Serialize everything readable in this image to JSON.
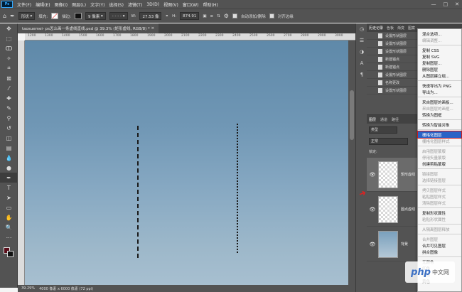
{
  "menubar": {
    "logo": "Ps",
    "items": [
      "文件(F)",
      "编辑(E)",
      "图像(I)",
      "图层(L)",
      "文字(Y)",
      "选择(S)",
      "滤镜(T)",
      "3D(D)",
      "视图(V)",
      "窗口(W)",
      "帮助(H)"
    ],
    "minimize": "—",
    "maximize": "□",
    "close": "✕"
  },
  "options": {
    "mode": "形状",
    "fill_label": "填充:",
    "stroke_label": "描边:",
    "stroke_width": "9 像素",
    "width_label": "W:",
    "width_value": "27.53 像",
    "height_label": "H:",
    "height_value": "874.91",
    "auto_add_label": "自动添加/删除",
    "align_edges_label": "对齐边缘"
  },
  "document": {
    "tab_title": "taosuemei- ps怎么画一条虚线直线.psd @ 39.3% (矩形虚线, RGB/8) *",
    "close_x": "×"
  },
  "ruler_ticks": [
    "1200",
    "1300",
    "1400",
    "1500",
    "1600",
    "1700",
    "1800",
    "1900",
    "2000",
    "2100",
    "2200",
    "2300",
    "2400",
    "2500",
    "2600",
    "2700",
    "2800",
    "2900",
    "3000"
  ],
  "status": {
    "zoom": "39.29%",
    "doc_size": "4000 像素 x 6000 像素 (72 ppi)"
  },
  "history": {
    "tabs": [
      "历史记录",
      "色板",
      "渐变",
      "图案"
    ],
    "rows": [
      "设置形状图层",
      "设置形状图层",
      "设置形状图层",
      "新建锚点",
      "新建锚点",
      "设置形状图层",
      "名称更改",
      "设置形状图层"
    ]
  },
  "layers": {
    "tabs": [
      "图层",
      "通道",
      "路径"
    ],
    "filter": "类型",
    "blend": "正常",
    "lock_label": "锁定:",
    "items": [
      {
        "name": "矩形虚线",
        "thumb": "checker"
      },
      {
        "name": "圆点虚线",
        "thumb": "checker"
      },
      {
        "name": "背景",
        "thumb": "photo"
      }
    ]
  },
  "context_menu": {
    "items": [
      {
        "label": "混合选项...",
        "state": "normal"
      },
      {
        "label": "编辑调整...",
        "state": "disabled"
      },
      {
        "sep": true
      },
      {
        "label": "复制 CSS",
        "state": "normal"
      },
      {
        "label": "复制 SVG",
        "state": "normal"
      },
      {
        "label": "复制图层...",
        "state": "normal"
      },
      {
        "label": "删除图层",
        "state": "normal"
      },
      {
        "label": "从图层建立组...",
        "state": "normal"
      },
      {
        "sep": true
      },
      {
        "label": "快速导出为 PNG",
        "state": "normal"
      },
      {
        "label": "导出为...",
        "state": "normal"
      },
      {
        "sep": true
      },
      {
        "label": "来自图层的画板...",
        "state": "normal"
      },
      {
        "label": "来自图层的画框...",
        "state": "disabled"
      },
      {
        "label": "转换为图框",
        "state": "normal"
      },
      {
        "sep": true
      },
      {
        "label": "转换为智能对象",
        "state": "normal"
      },
      {
        "sep": true
      },
      {
        "label": "栅格化图层",
        "state": "highlight"
      },
      {
        "label": "栅格化图层样式",
        "state": "disabled"
      },
      {
        "sep": true
      },
      {
        "label": "启用图层蒙版",
        "state": "disabled"
      },
      {
        "label": "停用矢量蒙版",
        "state": "disabled"
      },
      {
        "label": "创建剪贴蒙版",
        "state": "normal"
      },
      {
        "sep": true
      },
      {
        "label": "链接图层",
        "state": "disabled"
      },
      {
        "label": "选择链接图层",
        "state": "disabled"
      },
      {
        "sep": true
      },
      {
        "label": "拷贝图层样式",
        "state": "disabled"
      },
      {
        "label": "粘贴图层样式",
        "state": "disabled"
      },
      {
        "label": "清除图层样式",
        "state": "disabled"
      },
      {
        "sep": true
      },
      {
        "label": "复制形状属性",
        "state": "normal"
      },
      {
        "label": "粘贴形状属性",
        "state": "disabled"
      },
      {
        "sep": true
      },
      {
        "label": "从隔离图层释放",
        "state": "disabled"
      },
      {
        "sep": true
      },
      {
        "label": "合并图层",
        "state": "disabled"
      },
      {
        "label": "合并可见图层",
        "state": "normal"
      },
      {
        "label": "拼合图像",
        "state": "normal"
      },
      {
        "sep": true
      },
      {
        "label": "无颜色",
        "state": "normal"
      },
      {
        "label": "红色",
        "state": "normal"
      },
      {
        "label": "橙色",
        "state": "normal"
      },
      {
        "label": "黄色",
        "state": "normal"
      }
    ]
  },
  "watermark": {
    "text": "php",
    "suffix": "中文网"
  },
  "colors": {
    "foreground": "#5a0e1a",
    "background": "#111111",
    "highlight": "#2a63c6",
    "arrow": "#e02020"
  }
}
